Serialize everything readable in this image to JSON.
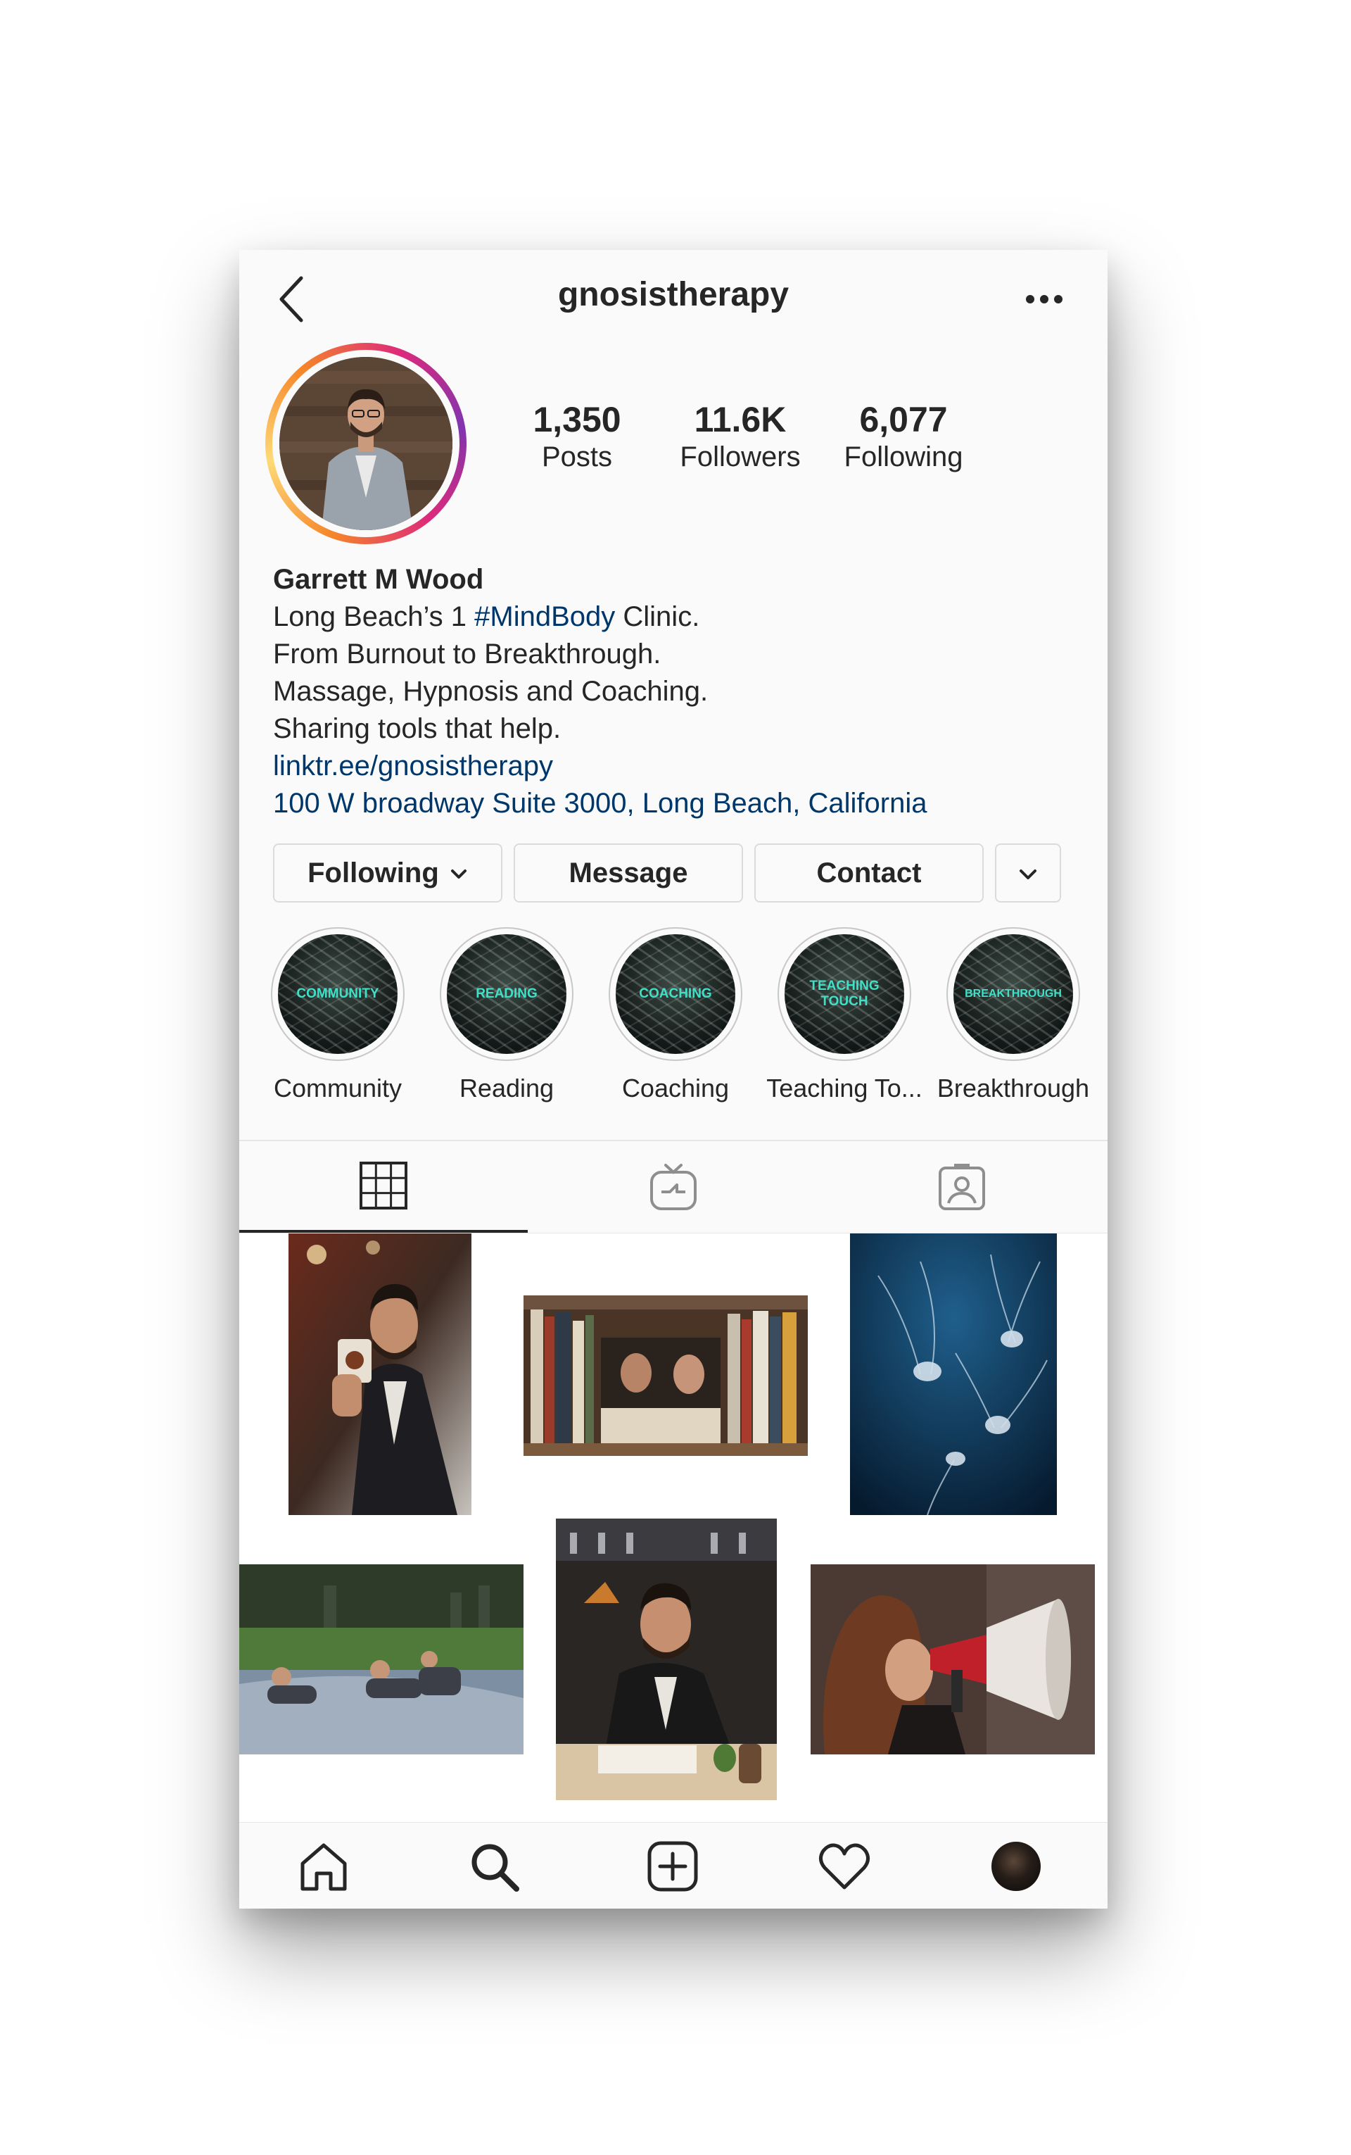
{
  "header": {
    "username": "gnosistherapy",
    "back_icon": "chevron-left-icon",
    "more_icon": "ellipsis-icon"
  },
  "stats": [
    {
      "value": "1,350",
      "label": "Posts"
    },
    {
      "value": "11.6K",
      "label": "Followers"
    },
    {
      "value": "6,077",
      "label": "Following"
    }
  ],
  "bio": {
    "name": "Garrett M Wood",
    "line1_prefix": "Long Beach’s 1 ",
    "line1_hashtag": "#MindBody",
    "line1_suffix": " Clinic.",
    "line2": "From Burnout to Breakthrough.",
    "line3": "Massage, Hypnosis and Coaching.",
    "line4": "Sharing tools that help.",
    "link": "linktr.ee/gnosistherapy",
    "address": "100 W broadway Suite 3000, Long Beach, California"
  },
  "actions": {
    "following": "Following",
    "message": "Message",
    "contact": "Contact"
  },
  "highlights": [
    {
      "cover_text": "COMMUNITY",
      "label": "Community"
    },
    {
      "cover_text": "READING",
      "label": "Reading"
    },
    {
      "cover_text": "COACHING",
      "label": "Coaching"
    },
    {
      "cover_text": "TEACHING TOUCH",
      "label": "Teaching To..."
    },
    {
      "cover_text": "BREAKTHROUGH",
      "label": "Breakthrough"
    }
  ],
  "tabs": [
    {
      "icon": "grid-icon",
      "active": true
    },
    {
      "icon": "igtv-icon",
      "active": false
    },
    {
      "icon": "tagged-icon",
      "active": false
    }
  ],
  "bottom_nav": [
    "home-icon",
    "search-icon",
    "new-post-icon",
    "heart-icon",
    "profile-avatar"
  ],
  "colors": {
    "link": "#00376b",
    "highlight_text": "#40e0c8",
    "text": "#262626"
  }
}
